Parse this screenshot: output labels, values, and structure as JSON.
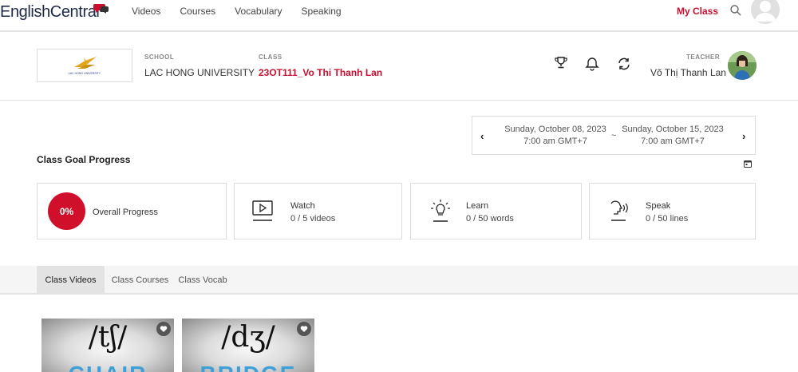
{
  "nav": {
    "logo_text": "EnglishCentral",
    "links": [
      "Videos",
      "Courses",
      "Vocabulary",
      "Speaking"
    ],
    "my_class": "My Class"
  },
  "class_header": {
    "school_label": "SCHOOL",
    "school_name": "LAC HONG UNIVERSITY",
    "school_logo_text": "LAC HONG UNIVERSITY",
    "class_label": "CLASS",
    "class_name": "23OT111_Vo Thi Thanh Lan",
    "teacher_label": "TEACHER",
    "teacher_name": "Võ Thị Thanh Lan"
  },
  "date_range": {
    "start_date": "Sunday, October 08, 2023",
    "start_time": "7:00 am GMT+7",
    "separator": "~",
    "end_date": "Sunday, October 15, 2023",
    "end_time": "7:00 am GMT+7"
  },
  "goal": {
    "title": "Class Goal Progress",
    "overall_percent": "0%",
    "overall_label": "Overall Progress",
    "watch_title": "Watch",
    "watch_progress": "0 / 5 videos",
    "learn_title": "Learn",
    "learn_progress": "0 / 50 words",
    "speak_title": "Speak",
    "speak_progress": "0 / 50 lines"
  },
  "tabs": [
    "Class Videos",
    "Class Courses",
    "Class Vocab"
  ],
  "videos": [
    {
      "ipa": "/tʃ/",
      "word": "CHAIR"
    },
    {
      "ipa": "/dʒ/",
      "word": "BRIDGE"
    }
  ],
  "colors": {
    "brand_red": "#c8102e",
    "progress_red": "#d0102b",
    "thumb_word_blue": "#3fa0d8"
  }
}
